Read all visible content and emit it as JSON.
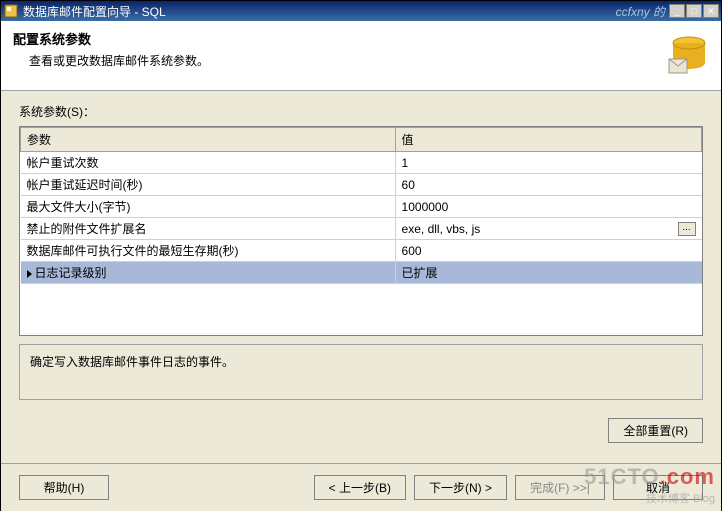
{
  "window": {
    "title": "数据库邮件配置向导 - SQL",
    "watermark_right": "ccfxny 的"
  },
  "header": {
    "title": "配置系统参数",
    "subtitle": "查看或更改数据库邮件系统参数。"
  },
  "section": {
    "label": "系统参数(S)："
  },
  "table": {
    "col_param": "参数",
    "col_value": "值",
    "rows": [
      {
        "param": "帐户重试次数",
        "value": "1",
        "has_dots": false
      },
      {
        "param": "帐户重试延迟时间(秒)",
        "value": "60",
        "has_dots": false
      },
      {
        "param": "最大文件大小(字节)",
        "value": "1000000",
        "has_dots": false
      },
      {
        "param": "禁止的附件文件扩展名",
        "value": "exe, dll, vbs, js",
        "has_dots": true
      },
      {
        "param": "数据库邮件可执行文件的最短生存期(秒)",
        "value": "600",
        "has_dots": false
      },
      {
        "param": "日志记录级别",
        "value": "已扩展",
        "has_dots": false,
        "selected": true
      }
    ]
  },
  "description": {
    "text": "确定写入数据库邮件事件日志的事件。"
  },
  "buttons": {
    "reset": "全部重置(R)",
    "help": "帮助(H)",
    "back": "< 上一步(B)",
    "next": "下一步(N) >",
    "finish": "完成(F) >>|",
    "cancel": "取消"
  },
  "overlay": {
    "line1": "51CTO",
    "line1b": ".com",
    "line2": "技术博客  Blog"
  }
}
